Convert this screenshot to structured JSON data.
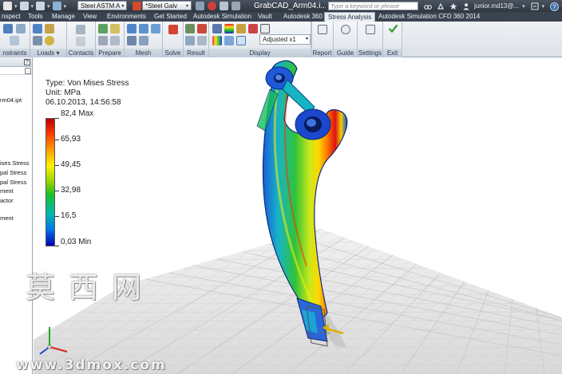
{
  "titlebar": {
    "material_combo": "Steel ASTM A",
    "appearance_combo": "*Steel Galv",
    "document_title": "GrabCAD_Arm04.i...",
    "search_placeholder": "Type a keyword or phrase",
    "user_name": "junior.md13@..."
  },
  "tabs": [
    "nspect",
    "Tools",
    "Manage",
    "View",
    "Environments",
    "Get Started",
    "Autodesk Simulation",
    "Vault",
    "Autodesk 360",
    "Stress Analysis",
    "Autodesk Simulation CFD 360 2014"
  ],
  "active_tab": "Stress Analysis",
  "ribbon": {
    "panels": [
      "nstraints",
      "Loads",
      "Contacts",
      "Prepare",
      "Mesh",
      "Solve",
      "Result",
      "Display",
      "Report",
      "Guide",
      "Settings",
      "Exit"
    ],
    "display_combo": "Adjusted x1"
  },
  "browser": {
    "help": "?",
    "items": [
      "rm04.ipt",
      "ises Stress",
      "pal Stress",
      "pal Stress",
      "ment",
      "actor",
      "ment"
    ]
  },
  "legend": {
    "type_line": "Type: Von Mises Stress",
    "unit_line": "Unit: MPa",
    "date_line": "06.10.2013, 14:56:58",
    "max_label": "82,4 Max",
    "min_label": "0,03 Min",
    "ticks": [
      "65,93",
      "49,45",
      "32,98",
      "16,5"
    ],
    "max_value": 82.4,
    "min_value": 0.03
  },
  "colors": {
    "active_tab_bg": "#e9edf2",
    "titlebar_bg": "#3a4350",
    "stress_max": "#b80000",
    "stress_min": "#0000b8"
  },
  "watermark": {
    "chars": "莫西网",
    "url": "www.3dmox.com"
  }
}
